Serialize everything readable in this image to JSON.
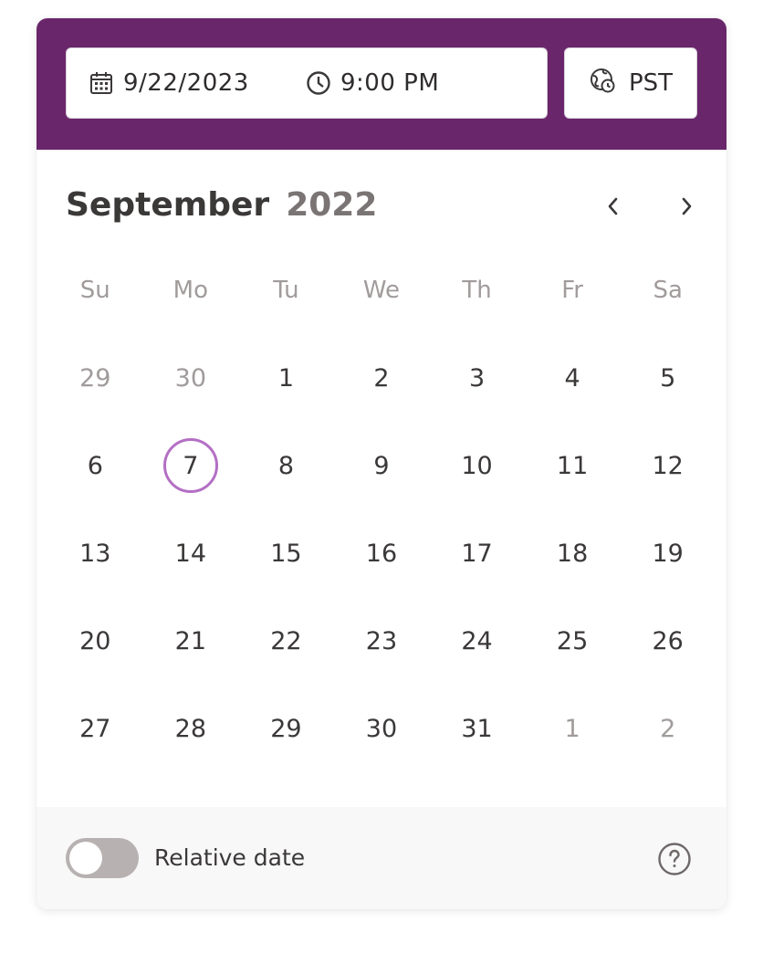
{
  "header": {
    "date_value": "9/22/2023",
    "time_value": "9:00 PM",
    "timezone_label": "PST",
    "background_color": "#6a266b"
  },
  "calendar": {
    "month": "September",
    "year": "2022",
    "weekdays": [
      "Su",
      "Mo",
      "Tu",
      "We",
      "Th",
      "Fr",
      "Sa"
    ],
    "weeks": [
      [
        {
          "d": "29",
          "muted": true
        },
        {
          "d": "30",
          "muted": true
        },
        {
          "d": "1"
        },
        {
          "d": "2"
        },
        {
          "d": "3"
        },
        {
          "d": "4"
        },
        {
          "d": "5"
        }
      ],
      [
        {
          "d": "6"
        },
        {
          "d": "7",
          "today": true
        },
        {
          "d": "8"
        },
        {
          "d": "9"
        },
        {
          "d": "10"
        },
        {
          "d": "11"
        },
        {
          "d": "12"
        }
      ],
      [
        {
          "d": "13"
        },
        {
          "d": "14"
        },
        {
          "d": "15"
        },
        {
          "d": "16"
        },
        {
          "d": "17"
        },
        {
          "d": "18"
        },
        {
          "d": "19"
        }
      ],
      [
        {
          "d": "20"
        },
        {
          "d": "21"
        },
        {
          "d": "22"
        },
        {
          "d": "23"
        },
        {
          "d": "24"
        },
        {
          "d": "25"
        },
        {
          "d": "26"
        }
      ],
      [
        {
          "d": "27"
        },
        {
          "d": "28"
        },
        {
          "d": "29"
        },
        {
          "d": "30"
        },
        {
          "d": "31"
        },
        {
          "d": "1",
          "muted": true
        },
        {
          "d": "2",
          "muted": true
        }
      ]
    ],
    "highlight_ring_color": "#b46fc4"
  },
  "footer": {
    "toggle_label": "Relative date",
    "toggle_on": false
  },
  "icons": {
    "date": "calendar-icon",
    "time": "clock-icon",
    "timezone": "globe-clock-icon",
    "prev": "chevron-left-icon",
    "next": "chevron-right-icon",
    "help": "question-circle-icon"
  }
}
